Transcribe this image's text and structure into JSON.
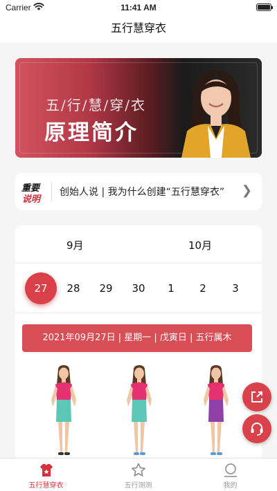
{
  "status_bar": {
    "carrier": "Carrier",
    "time": "11:41 AM"
  },
  "nav": {
    "title": "五行慧穿衣"
  },
  "banner": {
    "title": "五/行/慧/穿/衣",
    "subtitle": "原理简介"
  },
  "notice": {
    "badge_top": "重要",
    "badge_bottom": "说明",
    "text": "创始人说 | 我为什么创建“五行慧穿衣”"
  },
  "calendar": {
    "months": [
      "9月",
      "10月"
    ],
    "days": [
      "27",
      "28",
      "29",
      "30",
      "1",
      "2",
      "3"
    ],
    "selected_day": "27",
    "info": "2021年09月27日 | 星期一 | 戊寅日 | 五行属木",
    "figures": [
      {
        "top_color": "#e5316f",
        "skirt_color": "#5cc7b6"
      },
      {
        "top_color": "#e5316f",
        "skirt_color": "#5cc7b6"
      },
      {
        "top_color": "#e5316f",
        "skirt_color": "#8e3fa8"
      }
    ]
  },
  "tabs": [
    {
      "label": "五行慧穿衣",
      "icon": "shirt-star-icon",
      "active": true
    },
    {
      "label": "五行测测",
      "icon": "star-outline-icon",
      "active": false
    },
    {
      "label": "我的",
      "icon": "person-icon",
      "active": false
    }
  ],
  "colors": {
    "accent": "#d9404a",
    "banner_red": "#b23846",
    "text": "#222222"
  }
}
